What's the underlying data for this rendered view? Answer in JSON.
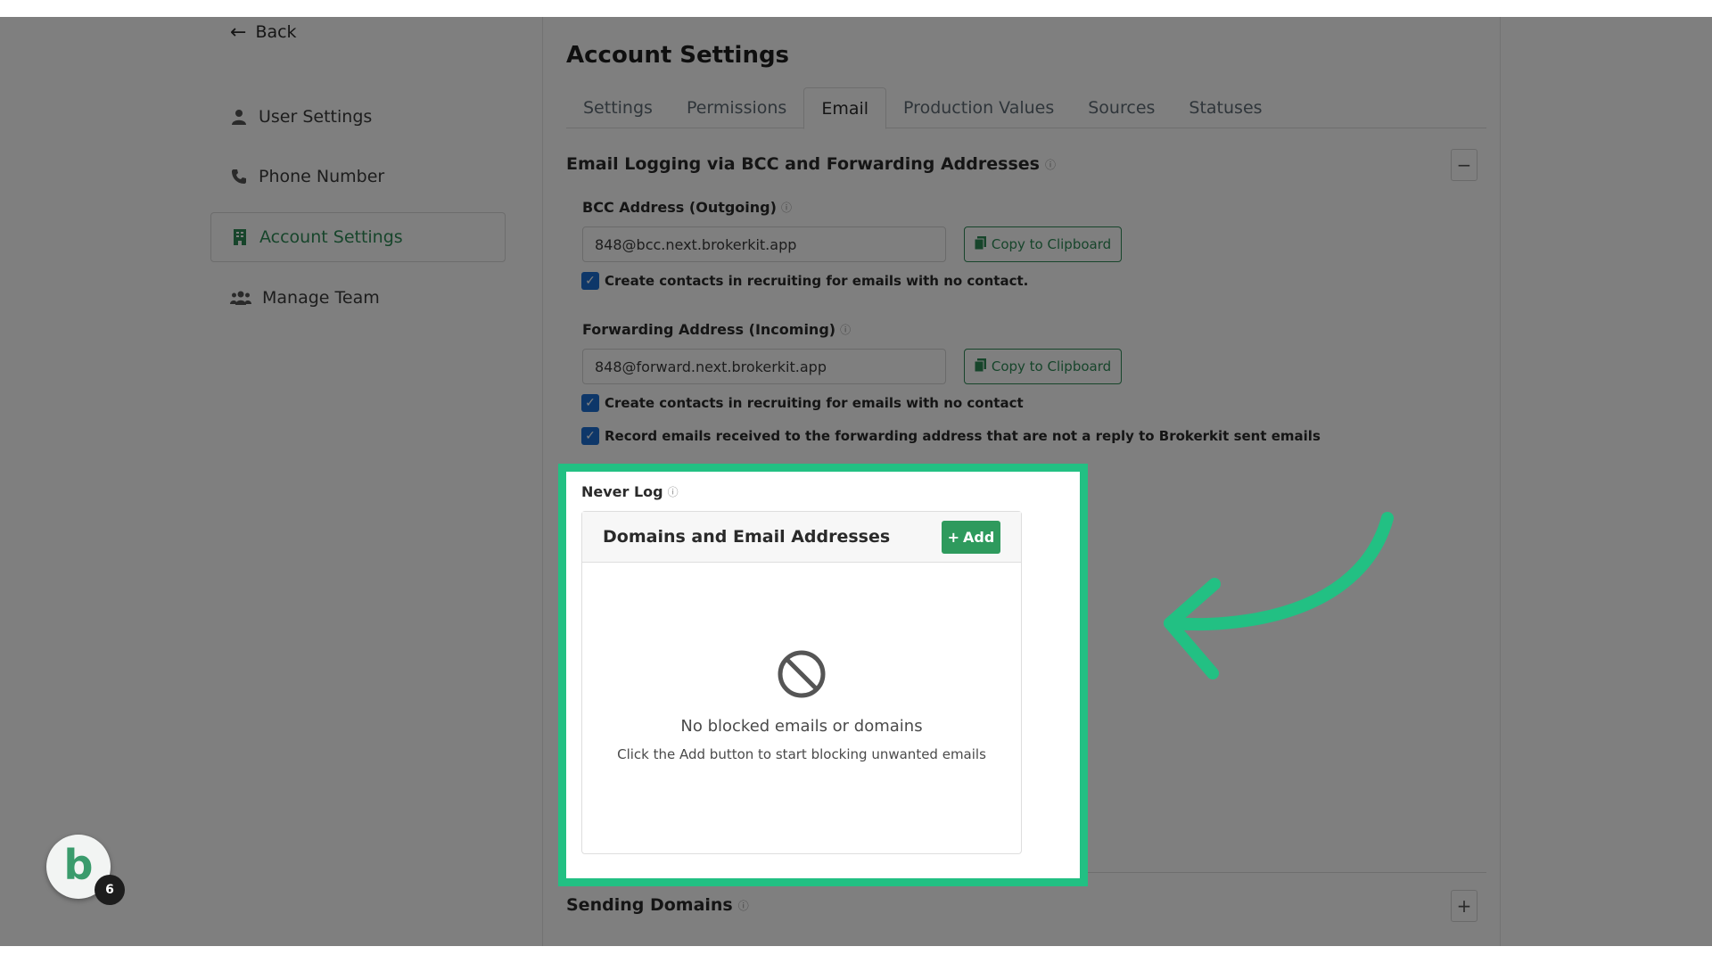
{
  "nav": {
    "back_label": "Back",
    "items": [
      {
        "label": "User Settings",
        "icon": "user-icon"
      },
      {
        "label": "Phone Number",
        "icon": "phone-icon"
      },
      {
        "label": "Account Settings",
        "icon": "building-icon",
        "active": true
      },
      {
        "label": "Manage Team",
        "icon": "team-icon"
      }
    ]
  },
  "main": {
    "title": "Account Settings",
    "tabs": [
      {
        "label": "Settings"
      },
      {
        "label": "Permissions"
      },
      {
        "label": "Email",
        "active": true
      },
      {
        "label": "Production Values"
      },
      {
        "label": "Sources"
      },
      {
        "label": "Statuses"
      }
    ],
    "email_logging": {
      "title": "Email Logging via BCC and Forwarding Addresses",
      "collapse_symbol": "−",
      "bcc": {
        "label": "BCC Address (Outgoing)",
        "value": "848@bcc.next.brokerkit.app",
        "copy_label": "Copy to Clipboard",
        "checkbox_label": "Create contacts in recruiting for emails with no contact."
      },
      "forwarding": {
        "label": "Forwarding Address (Incoming)",
        "value": "848@forward.next.brokerkit.app",
        "copy_label": "Copy to Clipboard",
        "checkbox1_label": "Create contacts in recruiting for emails with no contact",
        "checkbox2_label": "Record emails received to the forwarding address that are not a reply to Brokerkit sent emails"
      }
    },
    "never_log": {
      "label": "Never Log",
      "card_title": "Domains and Email Addresses",
      "add_label": "Add",
      "empty_title": "No blocked emails or domains",
      "empty_subtitle": "Click the Add button to start blocking unwanted emails"
    },
    "sending_domains": {
      "title": "Sending Domains",
      "expand_symbol": "+"
    }
  },
  "avatar": {
    "letter": "b",
    "badge_count": "6"
  },
  "colors": {
    "accent_green": "#2e8a57",
    "highlight_green": "#22c083",
    "checkbox_blue": "#1d6fd3"
  }
}
